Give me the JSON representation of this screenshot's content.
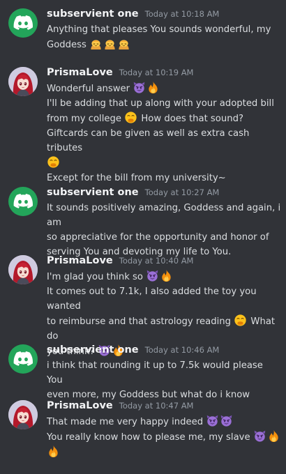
{
  "channel": {
    "messages": [
      {
        "author": "subservient one",
        "avatar": "discord-logo",
        "time": "Today at 10:18 AM",
        "lines": [
          {
            "text": "Anything that pleases You sounds wonderful, my"
          },
          {
            "text": "Goddess",
            "emojis": [
              "bowing-person",
              "bowing-person",
              "bowing-person"
            ]
          }
        ]
      },
      {
        "author": "PrismaLove",
        "avatar": "anime-girl-red-hair",
        "time": "Today at 10:19 AM",
        "lines": [
          {
            "text": "Wonderful answer",
            "emojis": [
              "smiling-imp",
              "fire"
            ]
          },
          {
            "text": "I'll be adding that up along with your adopted bill"
          },
          {
            "text": "from my college",
            "emojis": [
              "hand-over-mouth"
            ],
            "after": "How does that sound?"
          },
          {
            "text": "Giftcards can be given as well as extra cash tributes"
          },
          {
            "text": "",
            "emojis": [
              "hand-over-mouth"
            ]
          },
          {
            "text": "Except for the bill from my university~"
          }
        ]
      },
      {
        "author": "subservient one",
        "avatar": "discord-logo",
        "time": "Today at 10:27 AM",
        "lines": [
          {
            "text": "It sounds positively amazing, Goddess and again, i am"
          },
          {
            "text": "so appreciative for the opportunity and honor of"
          },
          {
            "text": "serving You and devoting my life to You."
          }
        ]
      },
      {
        "author": "PrismaLove",
        "avatar": "anime-girl-red-hair",
        "time": "Today at 10:40 AM",
        "lines": [
          {
            "text": "I'm glad you think so",
            "emojis": [
              "smiling-imp",
              "fire"
            ]
          },
          {
            "text": "It comes out to 7.1k, I also added the toy you wanted"
          },
          {
            "text": "to reimburse and that astrology reading",
            "emojis": [
              "hand-over-mouth"
            ],
            "after": "What do"
          },
          {
            "text": "you think?",
            "emojis": [
              "smiling-imp",
              "fire"
            ]
          }
        ]
      },
      {
        "author": "subservient one",
        "avatar": "discord-logo",
        "time": "Today at 10:46 AM",
        "lines": [
          {
            "text": "i think that rounding it up to 7.5k would please You"
          },
          {
            "text": "even more, my Goddess but what do i know"
          }
        ]
      },
      {
        "author": "PrismaLove",
        "avatar": "anime-girl-red-hair",
        "time": "Today at 10:47 AM",
        "lines": [
          {
            "text": "That made me very happy indeed",
            "emojis": [
              "smiling-imp",
              "smiling-imp"
            ]
          },
          {
            "text": "You really know how to please me, my slave",
            "emojis": [
              "smiling-imp",
              "fire"
            ]
          },
          {
            "text": "",
            "emojis": [
              "fire"
            ]
          }
        ]
      }
    ]
  }
}
